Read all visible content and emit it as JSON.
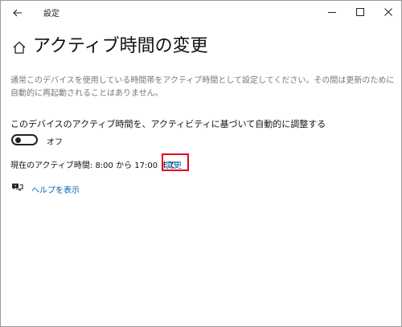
{
  "window": {
    "title": "設定"
  },
  "header": {
    "title": "アクティブ時間の変更"
  },
  "description": "通常このデバイスを使用している時間帯をアクティブ時間として設定してください。その間は更新のために自動的に再起動されることはありません。",
  "auto_adjust": {
    "label": "このデバイスのアクティブ時間を、アクティビティに基づいて自動的に調整する",
    "toggle_state": "オフ"
  },
  "current_hours": {
    "text": "現在のアクティブ時間: 8:00 から 17:00 まで",
    "change_label": "変更"
  },
  "help": {
    "label": "ヘルプを表示"
  },
  "colors": {
    "link": "#0063b1",
    "highlight": "#e3001b",
    "description": "#777777"
  },
  "icons": [
    "back-arrow-icon",
    "minimize-icon",
    "maximize-icon",
    "close-icon",
    "home-icon",
    "help-chat-icon"
  ]
}
